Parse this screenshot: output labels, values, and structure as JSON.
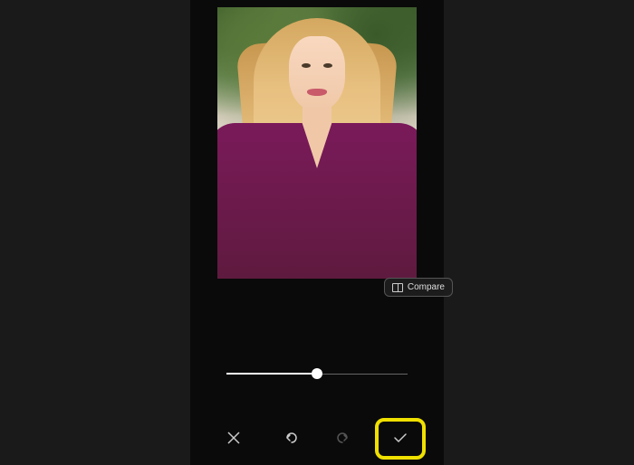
{
  "compare": {
    "label": "Compare"
  },
  "slider": {
    "value": 50,
    "min": 0,
    "max": 100
  },
  "toolbar": {
    "cancel": "close",
    "undo": "undo",
    "redo": "redo",
    "confirm": "check"
  },
  "highlight": {
    "target": "confirm-button",
    "color": "#f0e000"
  }
}
